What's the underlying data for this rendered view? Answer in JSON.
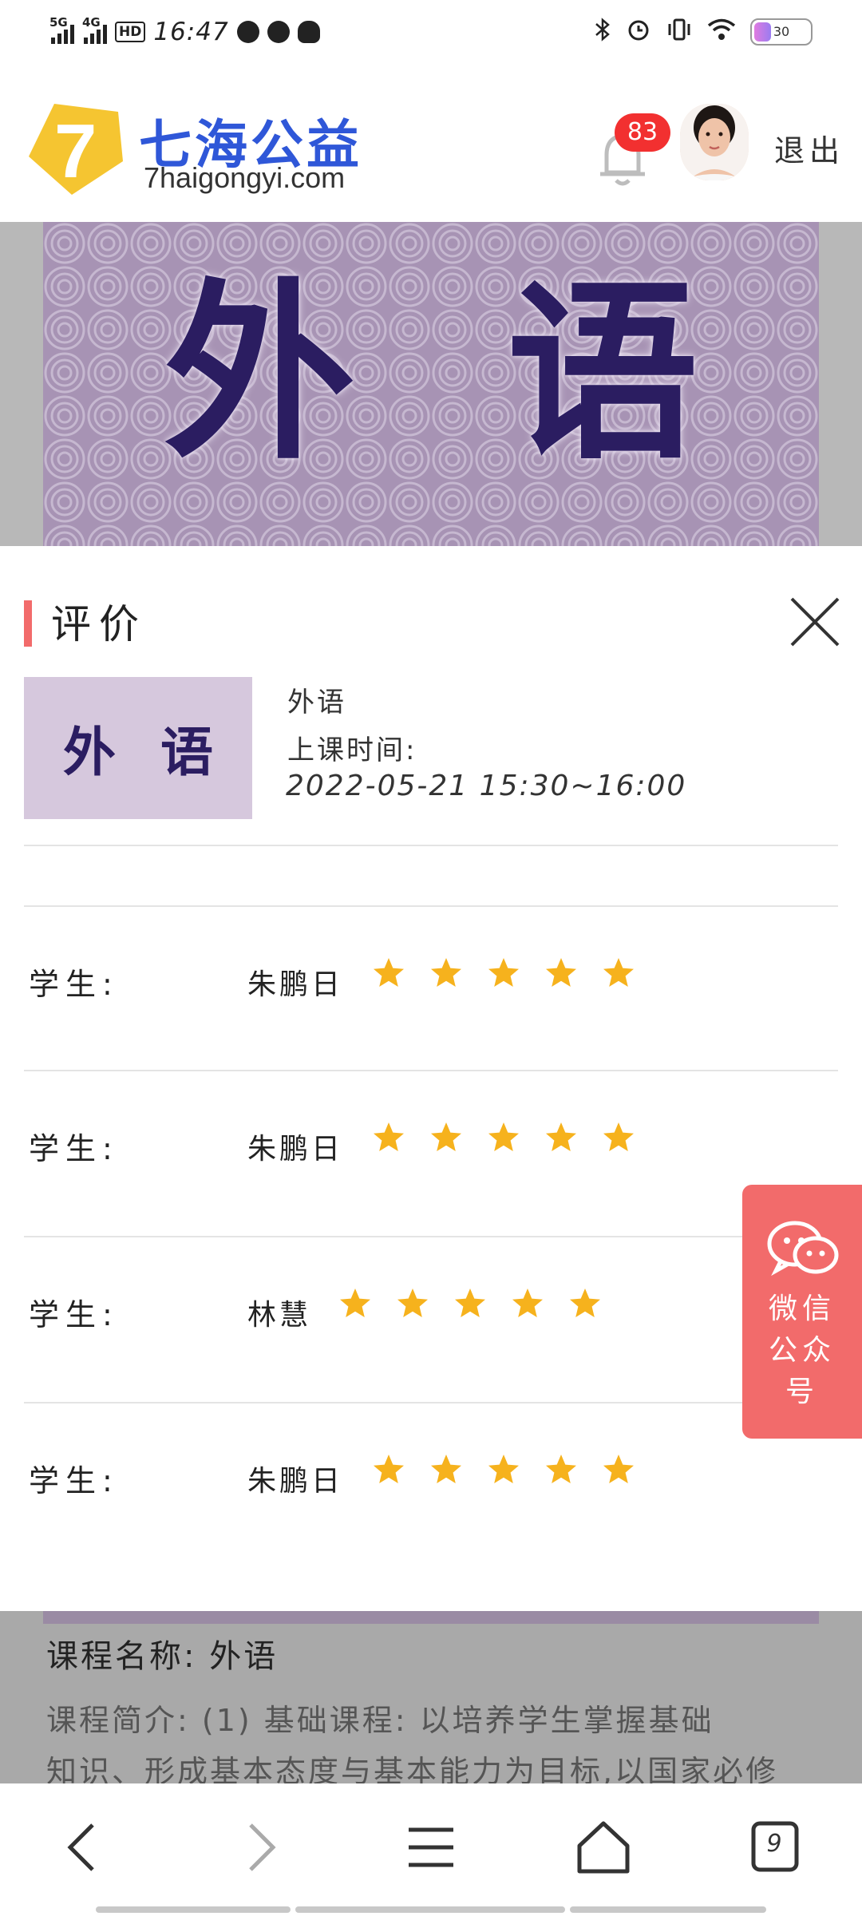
{
  "status_bar": {
    "net1": "5G",
    "net2": "4G",
    "hd": "HD",
    "time": "16:47",
    "battery_pct": "30",
    "battery_level": 0.3
  },
  "header": {
    "logo_badge_text": "7",
    "logo_cn": "七海公益",
    "logo_en": "7haigongyi.com",
    "notification_count": "83",
    "logout_label": "退出"
  },
  "banner": {
    "char1": "外",
    "char2": "语"
  },
  "modal": {
    "title": "评价",
    "thumb_char1": "外",
    "thumb_char2": "语",
    "course_name": "外语",
    "class_time_label": "上课时间:",
    "class_time": "2022-05-21 15:30~16:00",
    "ratings": [
      {
        "label": "学生:",
        "student": "朱鹏日",
        "stars": 5
      },
      {
        "label": "学生:",
        "student": "朱鹏日",
        "stars": 5
      },
      {
        "label": "学生:",
        "student": "林慧",
        "stars": 5
      },
      {
        "label": "学生:",
        "student": "朱鹏日",
        "stars": 5
      }
    ]
  },
  "wechat_float": {
    "line1": "微信",
    "line2": "公众",
    "line3": "号"
  },
  "behind_content": {
    "course_name_line": "课程名称: 外语",
    "intro_line1": "课程简介: (1) 基础课程: 以培养学生掌握基础",
    "intro_line2": "知识、形成基本态度与基本能力为目标,以国家必修"
  },
  "bottom_nav": {
    "tab_count": "9"
  },
  "colors": {
    "accent_red": "#f26b6b",
    "star_gold": "#f6b21d",
    "brand_blue": "#2f57d8",
    "logo_yellow": "#f5c531",
    "badge_red": "#f23030"
  }
}
